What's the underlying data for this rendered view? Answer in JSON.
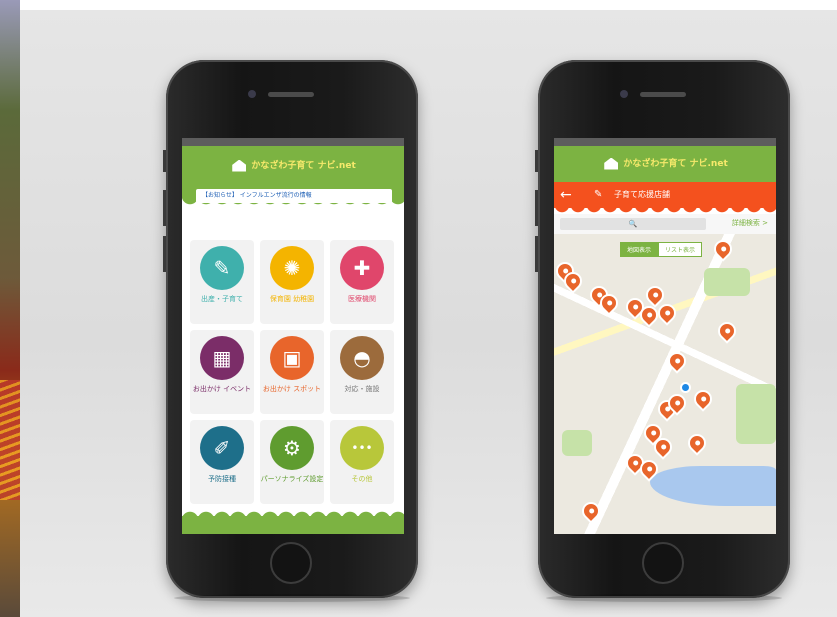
{
  "phone1": {
    "logo": "かなざわ子育て ナビ.net",
    "notice": "【お知らせ】 インフルエンザ流行の情報",
    "tiles": [
      {
        "label": "出産・子育て",
        "icon": "pencil-icon",
        "color": "#3fb0ac",
        "glyph": "✎"
      },
      {
        "label": "保育園 幼稚園",
        "icon": "sun-icon",
        "color": "#f4b400",
        "glyph": "✺"
      },
      {
        "label": "医療機関",
        "icon": "medical-cross-icon",
        "color": "#e0466b",
        "glyph": "✚"
      },
      {
        "label": "お出かけ イベント",
        "icon": "calendar-icon",
        "color": "#7b2d68",
        "glyph": "▦"
      },
      {
        "label": "お出かけ スポット",
        "icon": "bag-icon",
        "color": "#e8652b",
        "glyph": "▣"
      },
      {
        "label": "対応・施設",
        "icon": "helmet-icon",
        "color": "#9c6b3c",
        "glyph": "◓"
      },
      {
        "label": "予防接種",
        "icon": "syringe-icon",
        "color": "#1e6f8a",
        "glyph": "✐"
      },
      {
        "label": "パーソナライズ設定",
        "icon": "gear-icon",
        "color": "#5f9c2f",
        "glyph": "⚙"
      },
      {
        "label": "その他",
        "icon": "more-icon",
        "color": "#b8c73a",
        "glyph": "•••"
      }
    ],
    "label_colors": [
      "#3fb0ac",
      "#f4b400",
      "#e0466b",
      "#7b2d68",
      "#e8652b",
      "#777777",
      "#1e6f8a",
      "#5f9c2f",
      "#b8c73a"
    ]
  },
  "phone2": {
    "logo": "かなざわ子育て ナビ.net",
    "title": "子育て応援店舗",
    "search_placeholder": "🔍",
    "detail_link": "詳細検索 >",
    "toggle_map": "地図表示",
    "toggle_list": "リスト表示"
  }
}
